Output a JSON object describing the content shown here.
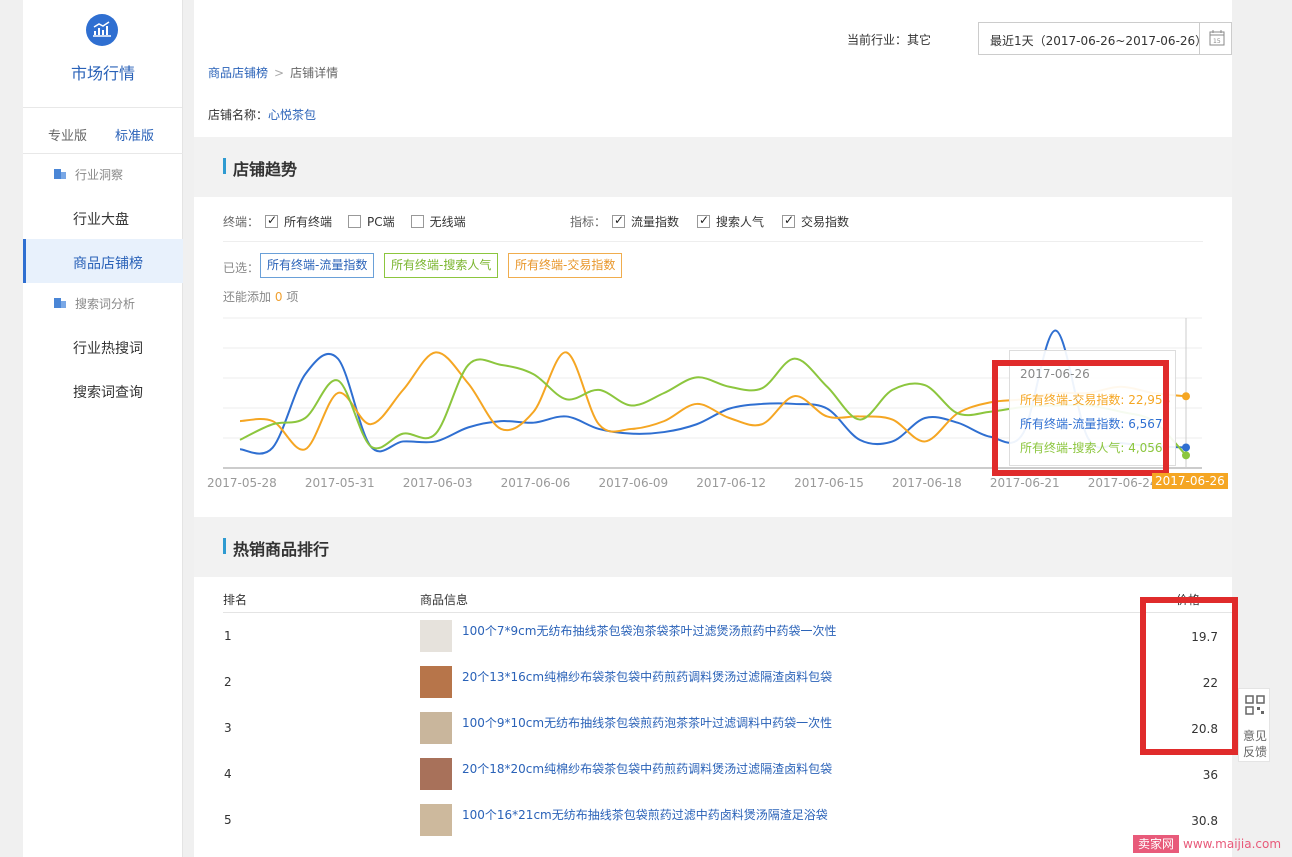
{
  "sidebar": {
    "title": "市场行情",
    "versions": [
      "专业版",
      "标准版"
    ],
    "groups": [
      {
        "label": "行业洞察",
        "items": [
          "行业大盘",
          "商品店铺榜"
        ]
      },
      {
        "label": "搜索词分析",
        "items": [
          "行业热搜词",
          "搜索词查询"
        ]
      }
    ],
    "active_item": "商品店铺榜"
  },
  "header": {
    "industry": "当前行业：其它",
    "date_range": "最近1天（2017-06-26~2017-06-26）"
  },
  "breadcrumb": {
    "parent": "商品店铺榜",
    "separator": ">",
    "current": "店铺详情"
  },
  "shop": {
    "label": "店铺名称：",
    "name": "心悦茶包"
  },
  "trend": {
    "title": "店铺趋势",
    "terminal_label": "终端：",
    "terminals": [
      "所有终端",
      "PC端",
      "无线端"
    ],
    "terminal_checked": [
      true,
      false,
      false
    ],
    "metric_label": "指标：",
    "metrics": [
      "流量指数",
      "搜索人气",
      "交易指数"
    ],
    "metric_checked": [
      true,
      true,
      true
    ],
    "selected_label": "已选：",
    "selected_tags": [
      "所有终端-流量指数",
      "所有终端-搜索人气",
      "所有终端-交易指数"
    ],
    "more_prefix": "还能添加",
    "more_count": "0",
    "more_suffix": "项",
    "tooltip": {
      "date": "2017-06-26",
      "rows": [
        "所有终端-交易指数: 22,958",
        "所有终端-流量指数: 6,567",
        "所有终端-搜索人气: 4,056"
      ]
    }
  },
  "chart_data": {
    "type": "line",
    "x": [
      "2017-05-28",
      "2017-05-29",
      "2017-05-30",
      "2017-05-31",
      "2017-06-01",
      "2017-06-02",
      "2017-06-03",
      "2017-06-04",
      "2017-06-05",
      "2017-06-06",
      "2017-06-07",
      "2017-06-08",
      "2017-06-09",
      "2017-06-10",
      "2017-06-11",
      "2017-06-12",
      "2017-06-13",
      "2017-06-14",
      "2017-06-15",
      "2017-06-16",
      "2017-06-17",
      "2017-06-18",
      "2017-06-19",
      "2017-06-20",
      "2017-06-21",
      "2017-06-22",
      "2017-06-23",
      "2017-06-24",
      "2017-06-25",
      "2017-06-26"
    ],
    "x_tick_labels": [
      "2017-05-28",
      "2017-05-31",
      "2017-06-03",
      "2017-06-06",
      "2017-06-09",
      "2017-06-12",
      "2017-06-15",
      "2017-06-18",
      "2017-06-21",
      "2017-06-24",
      "2017-06-26"
    ],
    "highlight_tick": "2017-06-26",
    "series": [
      {
        "name": "所有终端-流量指数",
        "color": "#2f6fd1",
        "values": [
          6000,
          6500,
          30000,
          35000,
          7000,
          8500,
          8500,
          13000,
          15000,
          14500,
          16500,
          12500,
          11000,
          11500,
          14000,
          19000,
          20500,
          20500,
          19000,
          9000,
          8500,
          16000,
          14500,
          10000,
          11000,
          44000,
          9500,
          8000,
          7000,
          6567
        ]
      },
      {
        "name": "所有终端-交易指数",
        "color": "#f5a623",
        "values": [
          15000,
          15000,
          6000,
          24000,
          14000,
          25000,
          37000,
          27000,
          12500,
          18000,
          37000,
          14000,
          12500,
          15000,
          20500,
          16000,
          14000,
          23000,
          16500,
          16500,
          15500,
          8500,
          17500,
          21000,
          22000,
          24000,
          24000,
          26000,
          24000,
          22958
        ]
      },
      {
        "name": "所有终端-搜索人气",
        "color": "#8cc63e",
        "values": [
          9000,
          14000,
          16000,
          28000,
          7000,
          11000,
          11000,
          33000,
          33000,
          30000,
          22000,
          25000,
          20000,
          24000,
          29000,
          26000,
          25500,
          35000,
          26000,
          15500,
          25000,
          26500,
          17500,
          18000,
          19500,
          20000,
          20000,
          18000,
          15000,
          4056
        ]
      }
    ],
    "ylim": [
      0,
      48000
    ],
    "grid": true
  },
  "ranking": {
    "title": "热销商品排行",
    "headers": [
      "排名",
      "商品信息",
      "价格"
    ],
    "rows": [
      {
        "rank": "1",
        "title": "100个7*9cm无纺布抽线茶包袋泡茶袋茶叶过滤煲汤煎药中药袋一次性",
        "price": "19.7"
      },
      {
        "rank": "2",
        "title": "20个13*16cm纯棉纱布袋茶包袋中药煎药调料煲汤过滤隔渣卤料包袋",
        "price": "22"
      },
      {
        "rank": "3",
        "title": "100个9*10cm无纺布抽线茶包袋煎药泡茶茶叶过滤调料中药袋一次性",
        "price": "20.8"
      },
      {
        "rank": "4",
        "title": "20个18*20cm纯棉纱布袋茶包袋中药煎药调料煲汤过滤隔渣卤料包袋",
        "price": "36"
      },
      {
        "rank": "5",
        "title": "100个16*21cm无纺布抽线茶包袋煎药过滤中药卤料煲汤隔渣足浴袋",
        "price": "30.8"
      }
    ]
  },
  "feedback": {
    "line1": "意见",
    "line2": "反馈"
  },
  "watermark": {
    "brand": "卖家网",
    "url": "www.maijia.com"
  }
}
